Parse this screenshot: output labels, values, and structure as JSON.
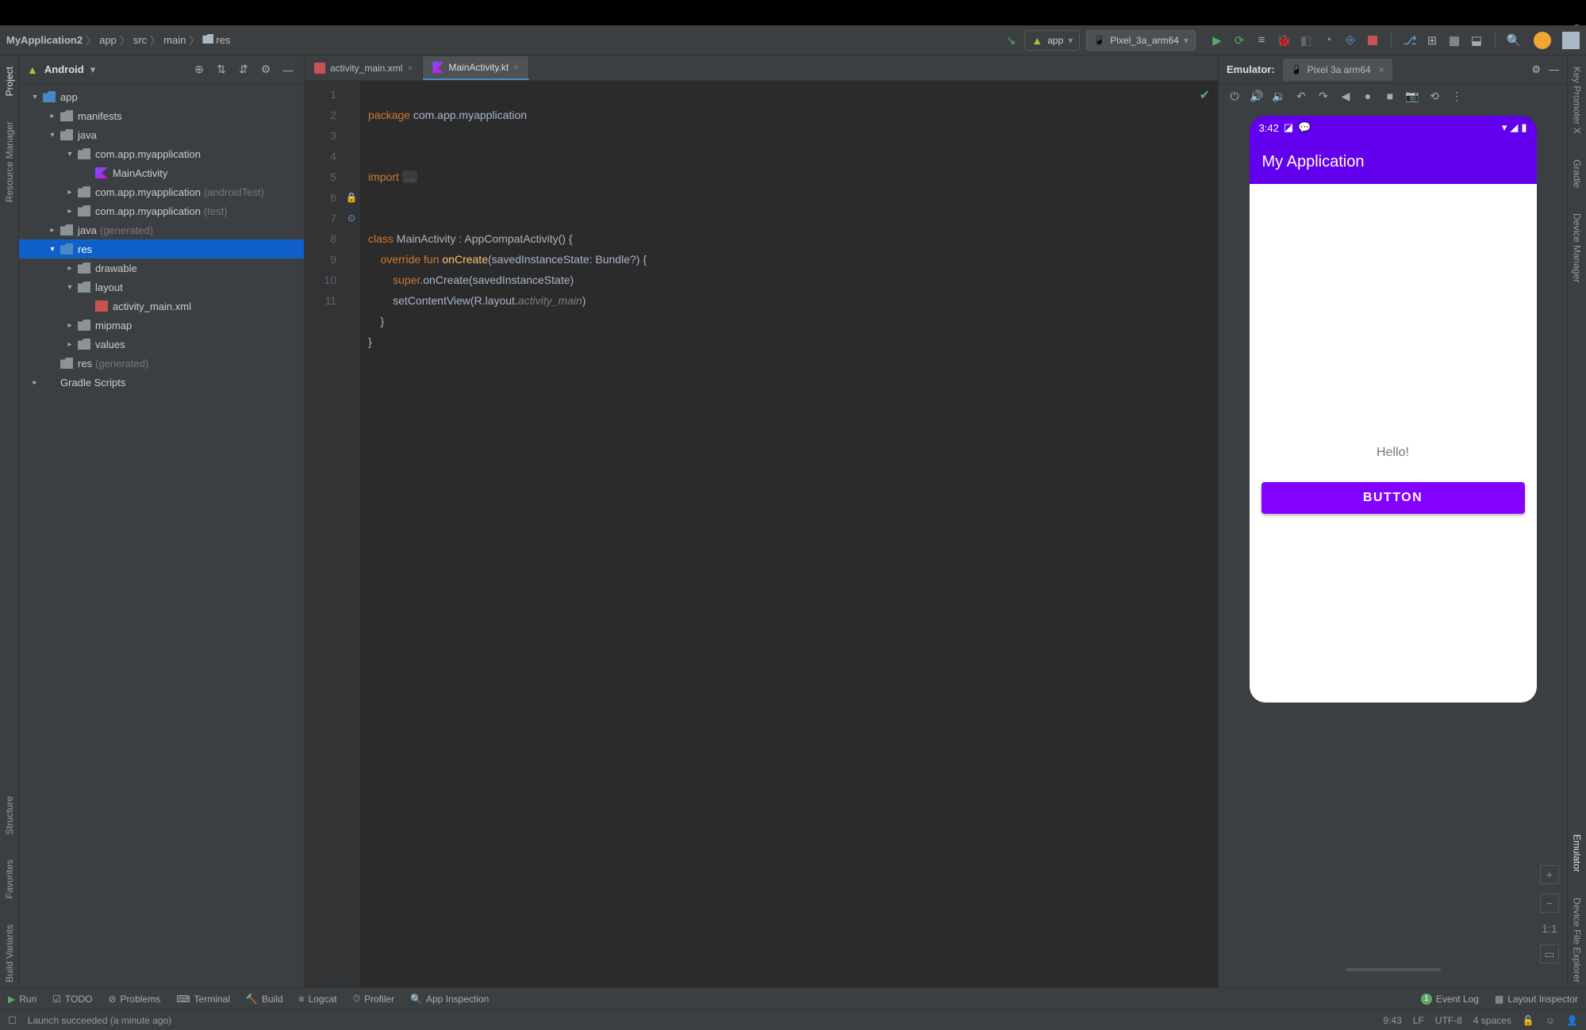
{
  "breadcrumbs": [
    "MyApplication2",
    "app",
    "src",
    "main",
    "res"
  ],
  "run": {
    "config": "app",
    "device": "Pixel_3a_arm64"
  },
  "projectHeader": {
    "title": "Android"
  },
  "tree": [
    {
      "d": 0,
      "tw": "▾",
      "icon": "folder blue",
      "label": "app"
    },
    {
      "d": 1,
      "tw": "▸",
      "icon": "folder",
      "label": "manifests"
    },
    {
      "d": 1,
      "tw": "▾",
      "icon": "folder",
      "label": "java"
    },
    {
      "d": 2,
      "tw": "▾",
      "icon": "folder pkg",
      "label": "com.app.myapplication"
    },
    {
      "d": 3,
      "tw": "",
      "icon": "kotlin",
      "label": "MainActivity"
    },
    {
      "d": 2,
      "tw": "▸",
      "icon": "folder pkg",
      "label": "com.app.myapplication",
      "dim": "(androidTest)"
    },
    {
      "d": 2,
      "tw": "▸",
      "icon": "folder pkg",
      "label": "com.app.myapplication",
      "dim": "(test)"
    },
    {
      "d": 1,
      "tw": "▸",
      "icon": "folder",
      "label": "java",
      "dim": "(generated)"
    },
    {
      "d": 1,
      "tw": "▾",
      "icon": "folder blue",
      "label": "res",
      "sel": true
    },
    {
      "d": 2,
      "tw": "▸",
      "icon": "folder",
      "label": "drawable"
    },
    {
      "d": 2,
      "tw": "▾",
      "icon": "folder",
      "label": "layout"
    },
    {
      "d": 3,
      "tw": "",
      "icon": "xml",
      "label": "activity_main.xml"
    },
    {
      "d": 2,
      "tw": "▸",
      "icon": "folder",
      "label": "mipmap"
    },
    {
      "d": 2,
      "tw": "▸",
      "icon": "folder",
      "label": "values"
    },
    {
      "d": 1,
      "tw": "",
      "icon": "folder",
      "label": "res",
      "dim": "(generated)"
    },
    {
      "d": 0,
      "tw": "▸",
      "icon": "gradle",
      "label": "Gradle Scripts"
    }
  ],
  "tabs": [
    {
      "name": "activity_main.xml",
      "icon": "xml",
      "active": false
    },
    {
      "name": "MainActivity.kt",
      "icon": "kt",
      "active": true
    }
  ],
  "code": {
    "lines": [
      1,
      2,
      3,
      4,
      5,
      6,
      7,
      8,
      9,
      10,
      11
    ],
    "gutterMarks": {
      "6": "lock",
      "7": "run"
    },
    "l1a": "package ",
    "l1b": "com.app.myapplication",
    "l3a": "import ",
    "l3b": "...",
    "l6": "class MainActivity : AppCompatActivity() {",
    "l6a": "class",
    "l6b": " MainActivity : AppCompatActivity() {",
    "l7a": "    override fun",
    "l7b": " onCreate",
    "l7c": "(savedInstanceState: Bundle?) {",
    "l8": "        super.onCreate(savedInstanceState)",
    "l8a": "        ",
    "l8b": "super",
    "l8c": ".onCreate(savedInstanceState)",
    "l9a": "        setContentView(R.layout.",
    "l9b": "activity_main",
    "l9c": ")",
    "l10": "    }",
    "l11": "}"
  },
  "emulator": {
    "label": "Emulator:",
    "tab": "Pixel 3a arm64",
    "statusTime": "3:42",
    "appTitle": "My Application",
    "bodyText": "Hello!",
    "buttonLabel": "BUTTON",
    "zoom11": "1:1"
  },
  "leftTabs": [
    "Project",
    "Resource Manager"
  ],
  "leftTabsBottom": [
    "Structure",
    "Favorites",
    "Build Variants"
  ],
  "rightTabs": [
    "Key Promoter X",
    "Gradle",
    "Device Manager"
  ],
  "rightTabsBottom": [
    "Emulator",
    "Device File Explorer"
  ],
  "bottomTools": [
    "Run",
    "TODO",
    "Problems",
    "Terminal",
    "Build",
    "Logcat",
    "Profiler",
    "App Inspection"
  ],
  "bottomRight": [
    "Event Log",
    "Layout Inspector"
  ],
  "status": {
    "msg": "Launch succeeded (a minute ago)",
    "pos": "9:43",
    "lf": "LF",
    "enc": "UTF-8",
    "indent": "4 spaces"
  }
}
